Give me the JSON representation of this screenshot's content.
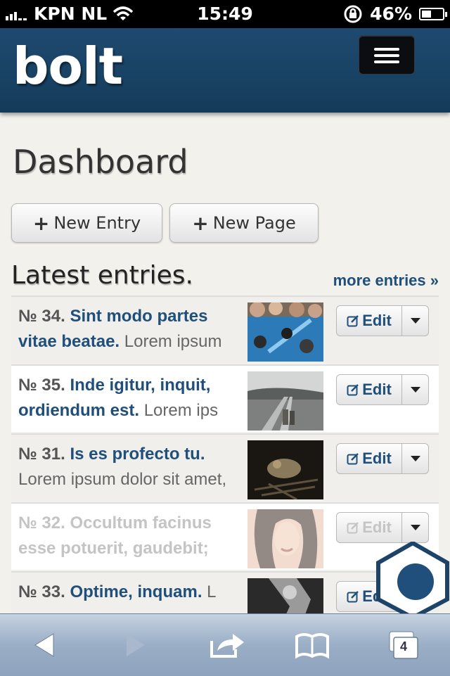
{
  "status_bar": {
    "carrier": "KPN NL",
    "time": "15:49",
    "battery_percent": "46%",
    "battery_level": 0.46
  },
  "navbar": {
    "brand": "bolt",
    "menu_icon": "hamburger-icon"
  },
  "page": {
    "title": "Dashboard",
    "new_entry_label": "New Entry",
    "new_page_label": "New Page"
  },
  "latest": {
    "title": "Latest entries.",
    "more_link": "more entries »"
  },
  "entries": [
    {
      "num": "№ 34.",
      "title": "Sint modo partes vitae beatae.",
      "excerpt": "Lorem ipsum",
      "edit": "Edit",
      "state": "published"
    },
    {
      "num": "№ 35.",
      "title": "Inde igitur, inquit, ordiendum est.",
      "excerpt": "Lorem ips",
      "edit": "Edit",
      "state": "published"
    },
    {
      "num": "№ 31.",
      "title": "Is es profecto tu.",
      "excerpt": "Lorem ipsum dolor sit amet,",
      "edit": "Edit",
      "state": "published"
    },
    {
      "num": "№ 32.",
      "title": "Occultum facinus esse potuerit, gaudebit;",
      "excerpt": "",
      "edit": "Edit",
      "state": "dimmed"
    },
    {
      "num": "№ 33.",
      "title": "Optime, inquam.",
      "excerpt": "L",
      "edit": "Edit",
      "state": "published"
    }
  ],
  "toolbar": {
    "tabs_count": "4",
    "icons": [
      "back-icon",
      "forward-icon",
      "share-icon",
      "bookmarks-icon",
      "tabs-icon"
    ]
  },
  "colors": {
    "navbar": "#1a4366",
    "link": "#1f4f7a",
    "background": "#f3f1ec"
  }
}
